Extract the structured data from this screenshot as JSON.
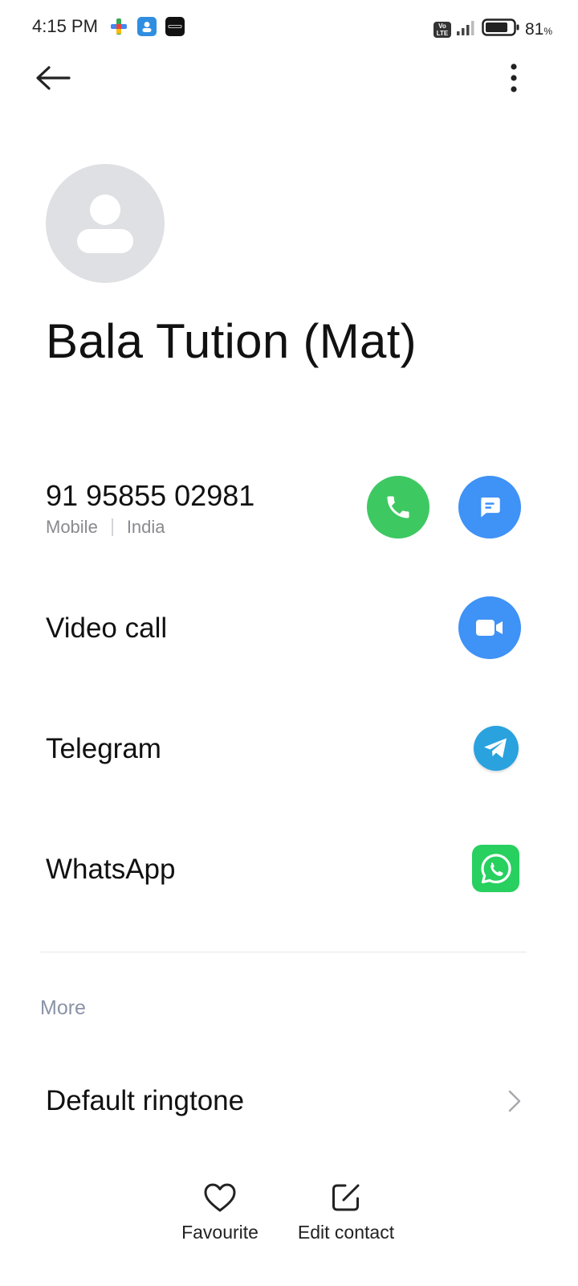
{
  "status_bar": {
    "time": "4:15 PM",
    "notification_icons": [
      "google-fit-icon",
      "contacts-app-icon",
      "dizo-app-icon"
    ],
    "network": "VoLTE",
    "volte_label_top": "Vo",
    "volte_label_bottom": "LTE",
    "battery_level": 81,
    "battery_percent": "81",
    "battery_unit": "%"
  },
  "contact": {
    "name": "Bala Tution (Mat)",
    "phone_number": "91 95855 02981",
    "phone_type": "Mobile",
    "phone_region": "India"
  },
  "actions": {
    "video_call_label": "Video call",
    "telegram_label": "Telegram",
    "whatsapp_label": "WhatsApp"
  },
  "more_section": {
    "header": "More",
    "default_ringtone_label": "Default ringtone"
  },
  "bottom_bar": {
    "favourite_label": "Favourite",
    "edit_contact_label": "Edit contact"
  },
  "colors": {
    "call_green": "#3ec862",
    "message_blue": "#3f92f6",
    "telegram_blue": "#2aa2de",
    "whatsapp_green": "#27d05f",
    "avatar_grey": "#dfe0e3"
  }
}
